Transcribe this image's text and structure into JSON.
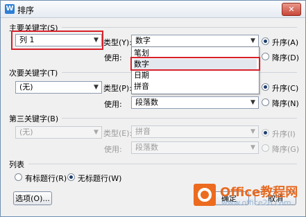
{
  "window": {
    "title": "排序"
  },
  "primary": {
    "group_label": "主要关键字(S)",
    "key_value": "列 1",
    "type_label": "类型(Y):",
    "type_value": "数字",
    "use_label": "使用:",
    "asc_label": "升序(A)",
    "desc_label": "降序(D)",
    "order": "asc"
  },
  "type_dropdown": {
    "options": [
      "笔划",
      "数字",
      "日期",
      "拼音"
    ],
    "selected": "数字"
  },
  "secondary": {
    "group_label": "次要关键字(T)",
    "key_value": "(无)",
    "type_label": "类型(P):",
    "use_label": "使用:",
    "use_value": "段落数",
    "asc_label": "升序(C)",
    "desc_label": "降序(N)",
    "order": "asc"
  },
  "tertiary": {
    "group_label": "第三关键字(B)",
    "key_value": "(无)",
    "type_label": "类型(E):",
    "type_value": "拼音",
    "use_label": "使用:",
    "use_value": "段落数",
    "asc_label": "升序(I)",
    "desc_label": "降序(G)",
    "order": "asc"
  },
  "list": {
    "group_label": "列表",
    "with_header": "有标题行(R)",
    "no_header": "无标题行(W)",
    "selected": "no_header"
  },
  "buttons": {
    "options": "选项(O)...",
    "ok": "确定",
    "cancel": "取消"
  },
  "watermark": {
    "brand": "Office教程网",
    "url": "www.office26.com"
  },
  "colors": {
    "highlight_border": "#d8202a",
    "watermark_orange": "#e76a22"
  }
}
